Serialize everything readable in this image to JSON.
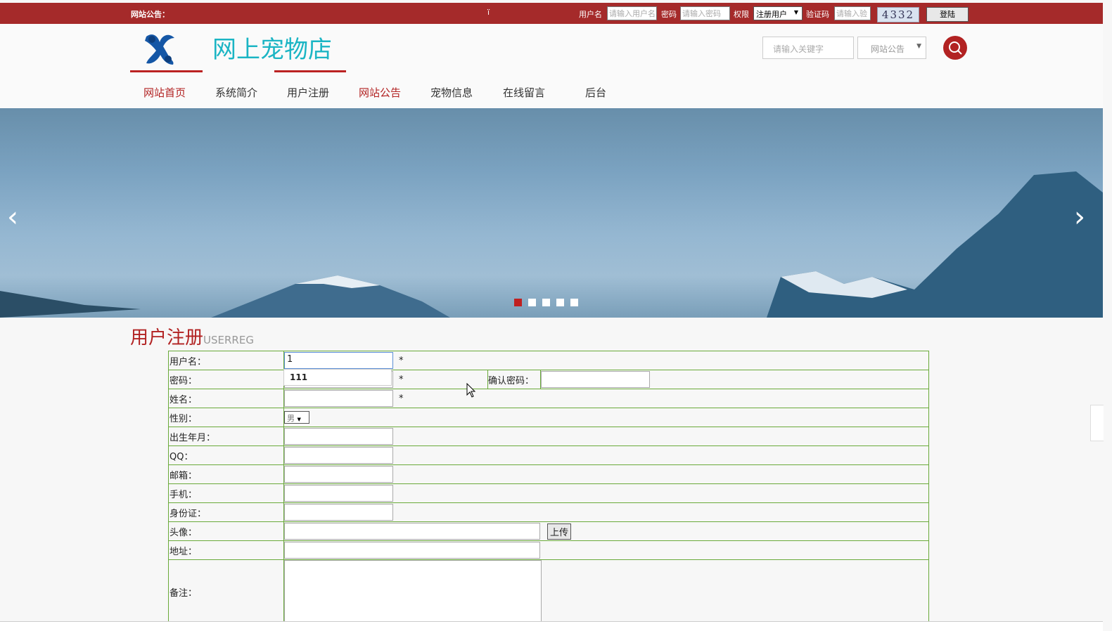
{
  "topbar": {
    "notice_label": "网站公告：",
    "marquee_text": "ï",
    "username_label": "用户名",
    "username_placeholder": "请输入用户名",
    "password_label": "密码",
    "password_placeholder": "请输入密码",
    "role_label": "权限",
    "role_value": "注册用户",
    "captcha_label": "验证码",
    "captcha_placeholder": "请输入验",
    "captcha_code": "4332",
    "login_button": "登陆"
  },
  "header": {
    "site_title": "网上宠物店",
    "search_placeholder": "请输入关键字",
    "search_category": "网站公告"
  },
  "nav": {
    "items": [
      "网站首页",
      "系统简介",
      "用户注册",
      "网站公告",
      "宠物信息",
      "在线留言",
      "后台"
    ]
  },
  "banner": {
    "slide_count": 5,
    "active_slide": 1
  },
  "form": {
    "title": "用户注册",
    "subtitle": "USERREG",
    "username_label": "用户名：",
    "username_value": "1",
    "password_label": "密码：",
    "confirm_password_label": "确认密码：",
    "name_label": "姓名：",
    "gender_label": "性别：",
    "gender_value": "男",
    "birth_label": "出生年月：",
    "qq_label": "QQ：",
    "email_label": "邮箱：",
    "phone_label": "手机：",
    "idcard_label": "身份证：",
    "avatar_label": "头像：",
    "upload_button": "上传",
    "address_label": "地址：",
    "remark_label": "备注：",
    "required_mark": "*",
    "autocomplete_suggestion": "111"
  },
  "colors": {
    "brand_red": "#a52a2a",
    "title_teal": "#1bb5c4",
    "table_border": "#6aaa3a"
  }
}
